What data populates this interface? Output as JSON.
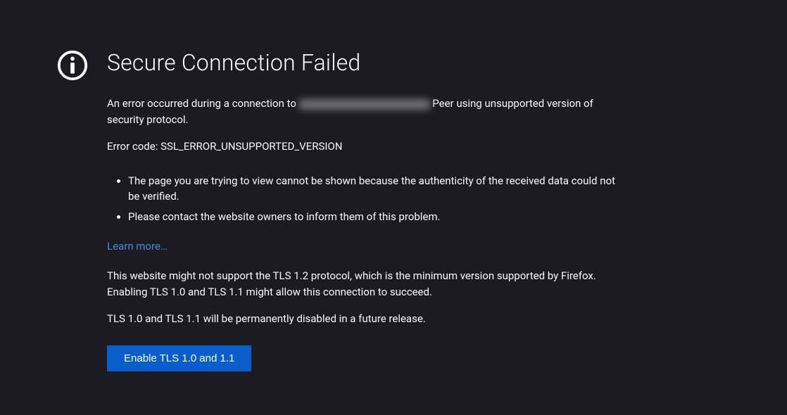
{
  "title": "Secure Connection Failed",
  "error": {
    "prefix": "An error occurred during a connection to ",
    "redacted_host": "████████████████",
    "suffix": " Peer using unsupported version of security protocol.",
    "code_label": "Error code: ",
    "code": "SSL_ERROR_UNSUPPORTED_VERSION"
  },
  "bullets": [
    "The page you are trying to view cannot be shown because the authenticity of the received data could not be verified.",
    "Please contact the website owners to inform them of this problem."
  ],
  "learn_more": "Learn more…",
  "tls_info": {
    "line1": "This website might not support the TLS 1.2 protocol, which is the minimum version supported by Firefox. Enabling TLS 1.0 and TLS 1.1 might allow this connection to succeed.",
    "line2": "TLS 1.0 and TLS 1.1 will be permanently disabled in a future release."
  },
  "button_label": "Enable TLS 1.0 and 1.1"
}
